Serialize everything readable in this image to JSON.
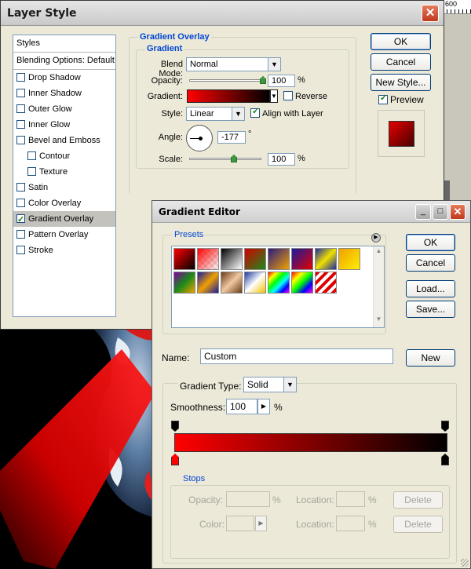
{
  "ruler": {
    "label": "600"
  },
  "layer_style": {
    "title": "Layer Style",
    "styles_header": "Styles",
    "blending": "Blending Options: Default",
    "items": [
      {
        "label": "Drop Shadow",
        "checked": false,
        "indent": false
      },
      {
        "label": "Inner Shadow",
        "checked": false,
        "indent": false
      },
      {
        "label": "Outer Glow",
        "checked": false,
        "indent": false
      },
      {
        "label": "Inner Glow",
        "checked": false,
        "indent": false
      },
      {
        "label": "Bevel and Emboss",
        "checked": false,
        "indent": false
      },
      {
        "label": "Contour",
        "checked": false,
        "indent": true
      },
      {
        "label": "Texture",
        "checked": false,
        "indent": true
      },
      {
        "label": "Satin",
        "checked": false,
        "indent": false
      },
      {
        "label": "Color Overlay",
        "checked": false,
        "indent": false
      },
      {
        "label": "Gradient Overlay",
        "checked": true,
        "indent": false,
        "selected": true
      },
      {
        "label": "Pattern Overlay",
        "checked": false,
        "indent": false
      },
      {
        "label": "Stroke",
        "checked": false,
        "indent": false
      }
    ],
    "group_title": "Gradient Overlay",
    "subgroup_title": "Gradient",
    "blend_mode_label": "Blend Mode:",
    "blend_mode_value": "Normal",
    "opacity_label": "Opacity:",
    "opacity_value": "100",
    "opacity_unit": "%",
    "gradient_label": "Gradient:",
    "reverse_label": "Reverse",
    "style_label": "Style:",
    "style_value": "Linear",
    "align_label": "Align with Layer",
    "angle_label": "Angle:",
    "angle_value": "-177",
    "angle_unit": "°",
    "scale_label": "Scale:",
    "scale_value": "100",
    "scale_unit": "%",
    "ok": "OK",
    "cancel": "Cancel",
    "new_style": "New Style...",
    "preview_label": "Preview"
  },
  "gradient_editor": {
    "title": "Gradient Editor",
    "presets_label": "Presets",
    "ok": "OK",
    "cancel": "Cancel",
    "load": "Load...",
    "save": "Save...",
    "name_label": "Name:",
    "name_value": "Custom",
    "new": "New",
    "gradient_type_label": "Gradient Type:",
    "gradient_type_value": "Solid",
    "smoothness_label": "Smoothness:",
    "smoothness_value": "100",
    "smoothness_unit": "%",
    "stops_label": "Stops",
    "opacity_label": "Opacity:",
    "opacity_unit": "%",
    "location_label": "Location:",
    "location_unit": "%",
    "delete": "Delete",
    "color_label": "Color:",
    "location_label2": "Location:",
    "location_unit2": "%",
    "delete2": "Delete",
    "minimize_glyph": "_",
    "maximize_glyph": "□",
    "close_glyph": "✕"
  },
  "colors": {
    "accent": "#0046d5",
    "gradient_start": "#ff0000",
    "gradient_end": "#000000"
  }
}
